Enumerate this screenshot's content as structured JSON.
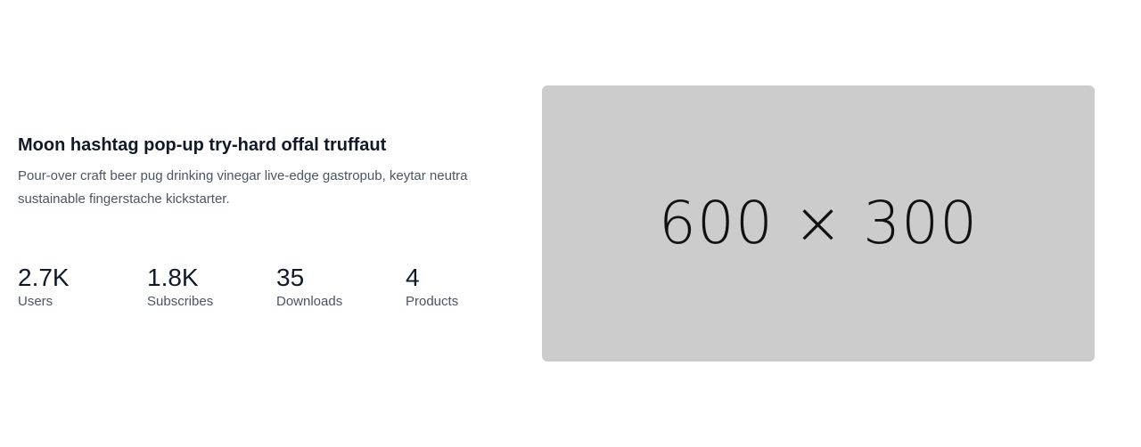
{
  "content": {
    "headline": "Moon hashtag pop-up try-hard offal truffaut",
    "description": "Pour-over craft beer pug drinking vinegar live-edge gastropub, keytar neutra sustainable fingerstache kickstarter.",
    "stats": [
      {
        "value": "2.7K",
        "label": "Users"
      },
      {
        "value": "1.8K",
        "label": "Subscribes"
      },
      {
        "value": "35",
        "label": "Downloads"
      },
      {
        "value": "4",
        "label": "Products"
      }
    ]
  },
  "image": {
    "placeholder_text": "600 × 300",
    "background_color": "#cccccc"
  }
}
